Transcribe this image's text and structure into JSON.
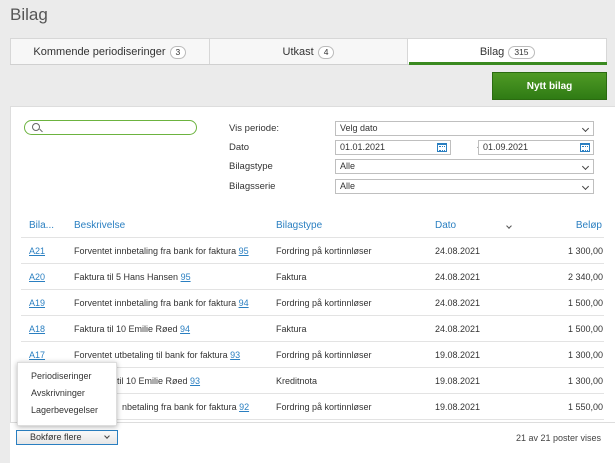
{
  "page_title": "Bilag",
  "tabs": [
    {
      "label": "Kommende periodiseringer",
      "count": "3"
    },
    {
      "label": "Utkast",
      "count": "4"
    },
    {
      "label": "Bilag",
      "count": "315"
    }
  ],
  "new_button": "Nytt bilag",
  "filters": {
    "search_placeholder": "",
    "period_label": "Vis periode:",
    "period_value": "Velg dato",
    "date_label": "Dato",
    "date_from": "01.01.2021",
    "date_separator": "-",
    "date_to": "01.09.2021",
    "type_label": "Bilagstype",
    "type_value": "Alle",
    "series_label": "Bilagsserie",
    "series_value": "Alle"
  },
  "table": {
    "headers": {
      "id": "Bila...",
      "desc": "Beskrivelse",
      "type": "Bilagstype",
      "date": "Dato",
      "amount": "Beløp"
    },
    "rows": [
      {
        "id": "A21",
        "desc": "Forventet innbetaling fra bank for faktura ",
        "ref": "95",
        "type": "Fordring på kortinnløser",
        "date": "24.08.2021",
        "amount": "1 300,00"
      },
      {
        "id": "A20",
        "desc": "Faktura til 5 Hans Hansen ",
        "ref": "95",
        "type": "Faktura",
        "date": "24.08.2021",
        "amount": "2 340,00"
      },
      {
        "id": "A19",
        "desc": "Forventet innbetaling fra bank for faktura ",
        "ref": "94",
        "type": "Fordring på kortinnløser",
        "date": "24.08.2021",
        "amount": "1 500,00"
      },
      {
        "id": "A18",
        "desc": "Faktura til 10 Emilie Røed ",
        "ref": "94",
        "type": "Faktura",
        "date": "24.08.2021",
        "amount": "1 500,00"
      },
      {
        "id": "A17",
        "desc": "Forventet utbetaling til bank for faktura ",
        "ref": "93",
        "type": "Fordring på kortinnløser",
        "date": "19.08.2021",
        "amount": "1 300,00"
      },
      {
        "id": "",
        "desc": "til 10 Emilie Røed ",
        "ref": "93",
        "type": "Kreditnota",
        "date": "19.08.2021",
        "amount": "1 300,00"
      },
      {
        "id": "",
        "desc": "nbetaling fra bank for faktura ",
        "ref": "92",
        "type": "Fordring på kortinnløser",
        "date": "19.08.2021",
        "amount": "1 550,00"
      }
    ]
  },
  "popup_menu": [
    "Periodiseringer",
    "Avskrivninger",
    "Lagerbevegelser"
  ],
  "footer": {
    "bulk_button": "Bokføre flere",
    "count_text": "21 av 21 poster vises"
  }
}
